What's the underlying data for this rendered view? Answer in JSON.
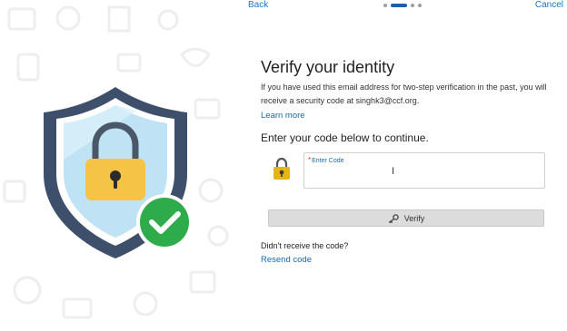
{
  "nav": {
    "back_label": "Back",
    "cancel_label": "Cancel",
    "steps": [
      {
        "active": false
      },
      {
        "active": true
      },
      {
        "active": false
      },
      {
        "active": false
      }
    ]
  },
  "main": {
    "title": "Verify your identity",
    "description": "If you have used this email address for two-step verification in the past, you will receive a security code at singhk3@ccf.org.",
    "learn_more_label": "Learn more",
    "instruction": "Enter your code below to continue.",
    "code_field": {
      "label": "Enter Code",
      "required_marker": "*",
      "value": ""
    },
    "verify_label": "Verify",
    "no_code_text": "Didn't receive the code?",
    "resend_label": "Resend code"
  },
  "icons": {
    "shield": "shield-lock-icon",
    "check": "checkmark-icon",
    "lock": "padlock-icon",
    "key": "key-icon",
    "cursor": "text-cursor-icon"
  },
  "colors": {
    "link": "#1a6aa8",
    "active_step": "#1f5fa8",
    "shield_outer": "#3d4f6b",
    "check_green": "#2eab4b",
    "lock_gold": "#f5c446"
  }
}
